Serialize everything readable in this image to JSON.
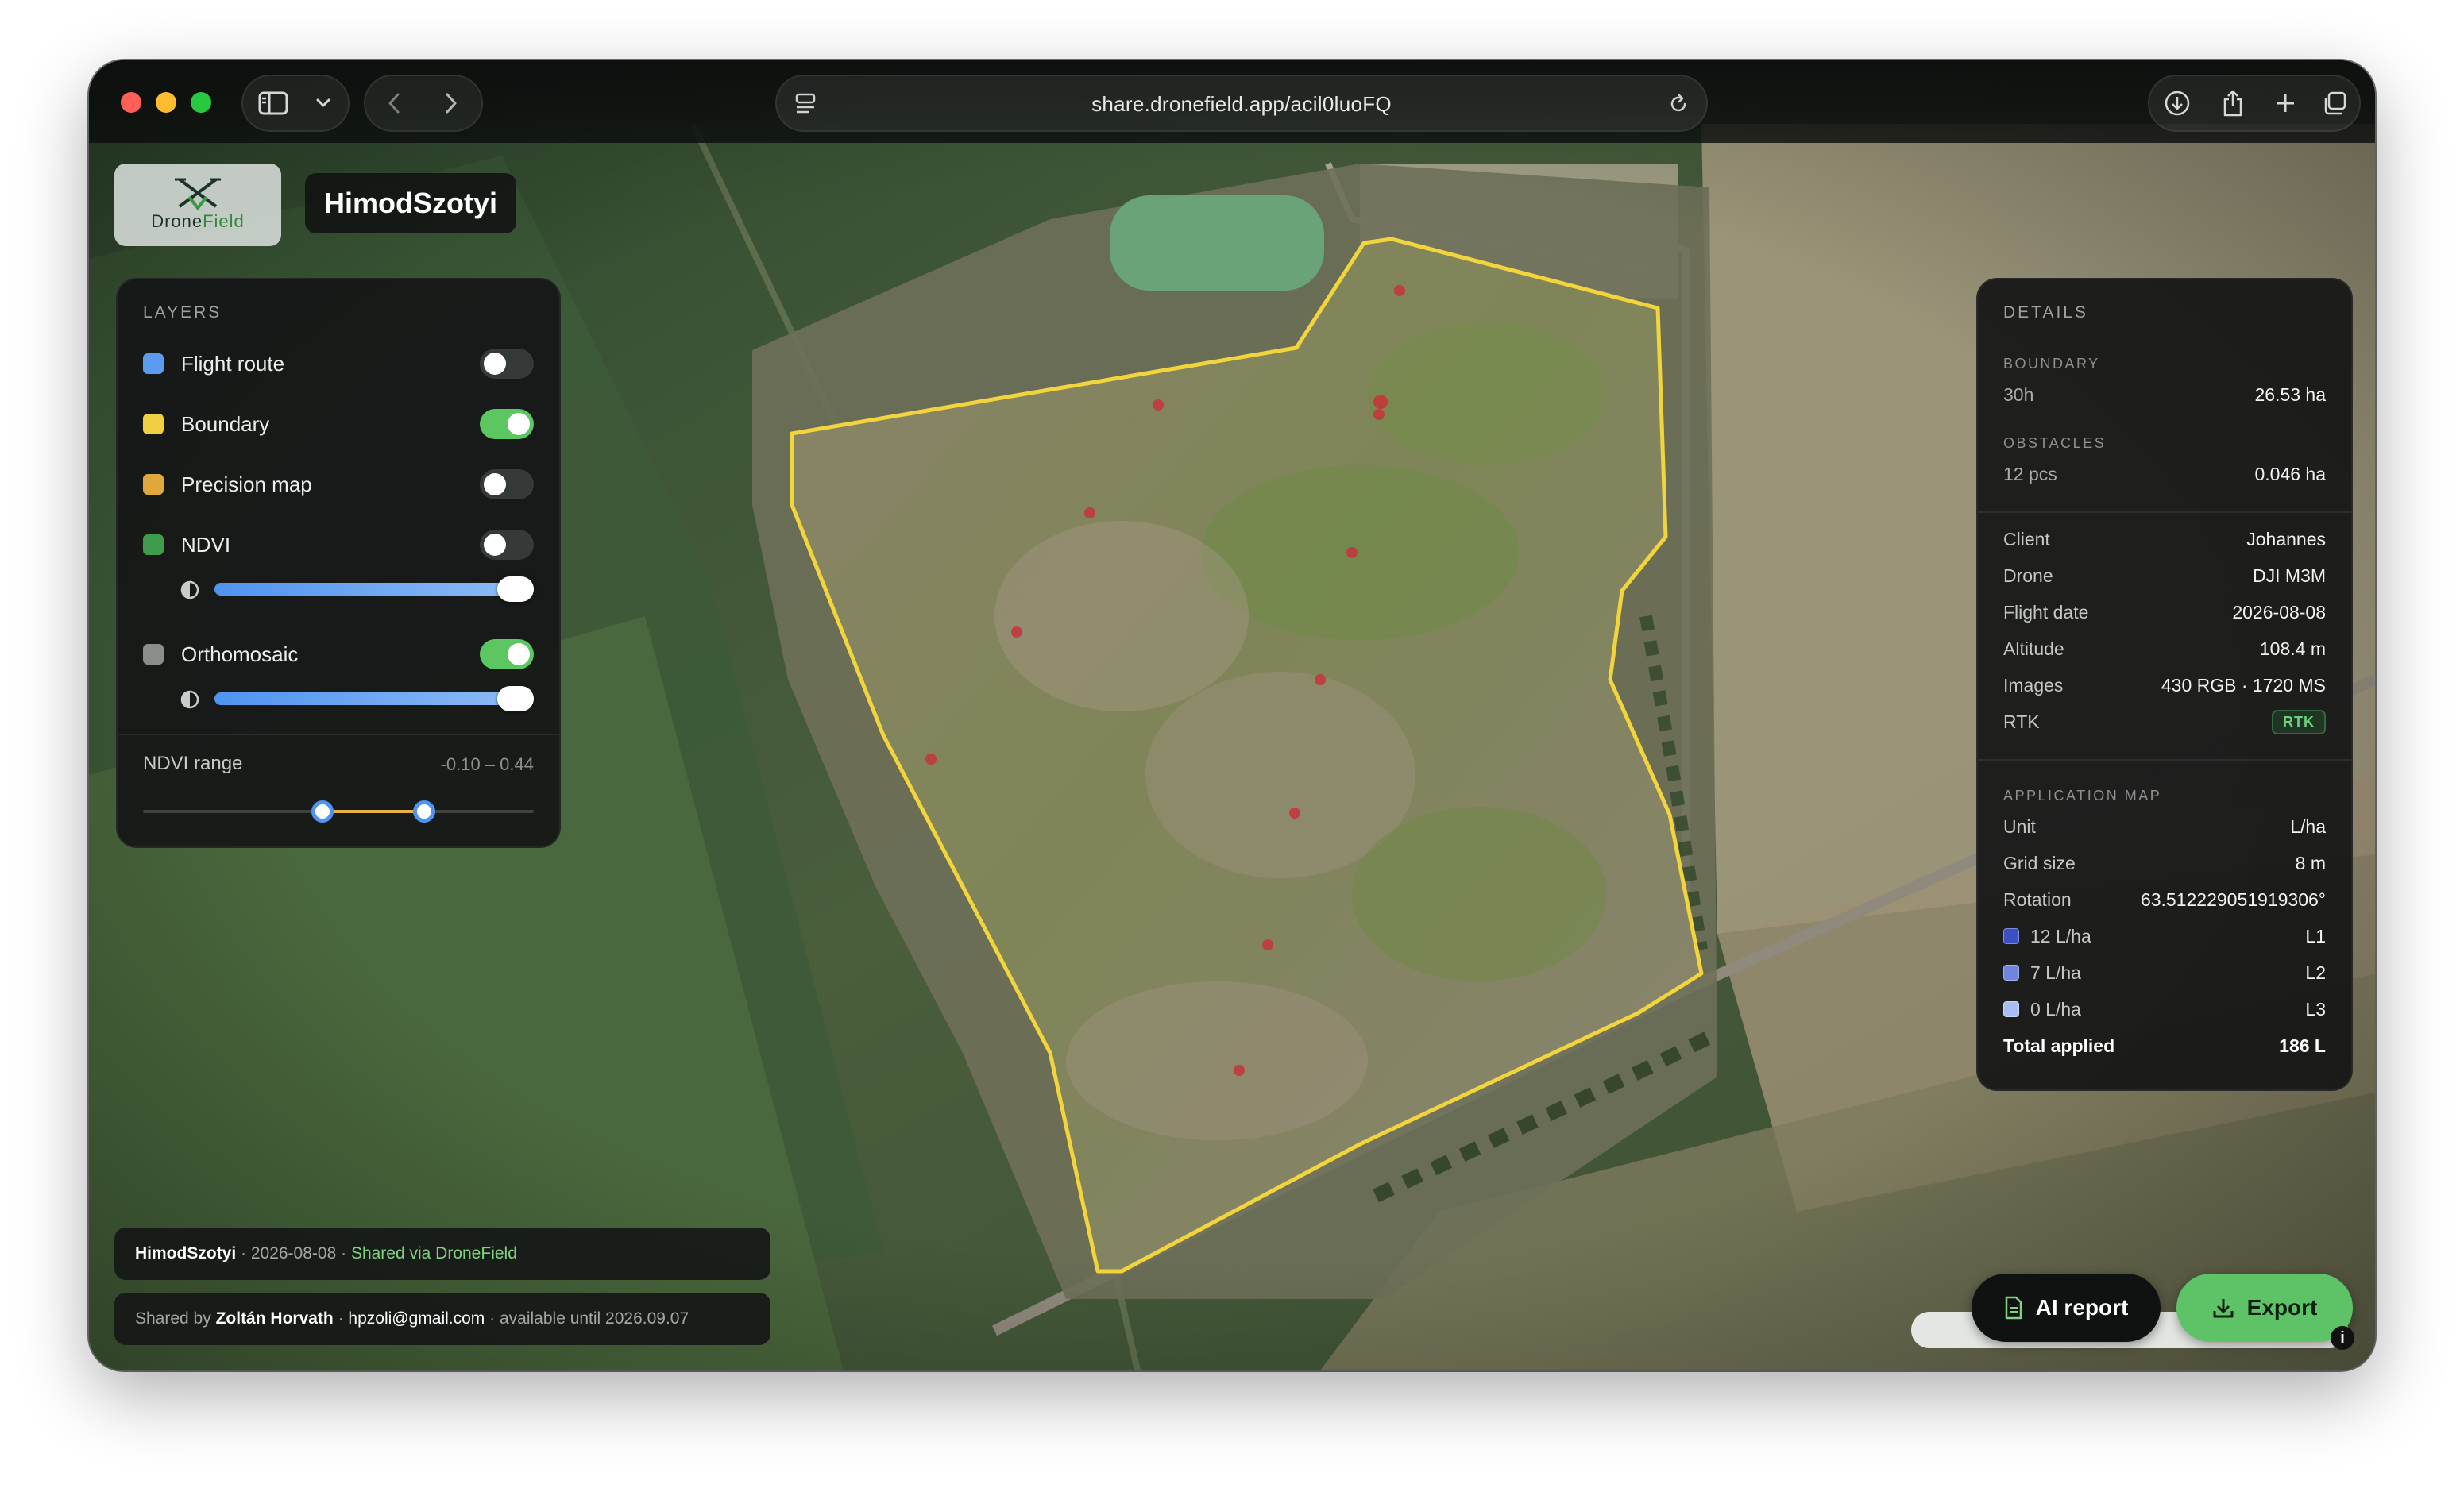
{
  "browser": {
    "url": "share.dronefield.app/acil0luoFQ",
    "colors": {
      "close": "#ff5f57",
      "minimize": "#febc2e",
      "zoom": "#28c840"
    },
    "icons": [
      "sidebar-icon",
      "chevron-down-icon",
      "back-icon",
      "forward-icon",
      "page-settings-icon",
      "reload-icon",
      "download-icon",
      "share-icon",
      "new-tab-icon",
      "tab-overview-icon"
    ]
  },
  "brand": {
    "logo_prefix": "Drone",
    "logo_suffix": "Field",
    "site_name": "HimodSzotyi"
  },
  "layers": {
    "title": "LAYERS",
    "items": [
      {
        "label": "Flight route",
        "color": "#5b9bf0",
        "enabled": false
      },
      {
        "label": "Boundary",
        "color": "#f0d042",
        "enabled": true
      },
      {
        "label": "Precision map",
        "color": "#e0a83c",
        "enabled": false
      },
      {
        "label": "NDVI",
        "color": "#3e9c4c",
        "enabled": false,
        "opacity": 1.0
      },
      {
        "label": "Orthomosaic",
        "color": "#8a8e8b",
        "enabled": true,
        "opacity": 1.0
      }
    ],
    "ndvi_range": {
      "label": "NDVI range",
      "value_text": "-0.10 – 0.44",
      "min": -0.1,
      "max": 0.44
    }
  },
  "details": {
    "title": "DETAILS",
    "boundary": {
      "label": "BOUNDARY",
      "name": "30h",
      "area": "26.53 ha"
    },
    "obstacles": {
      "label": "OBSTACLES",
      "count": "12 pcs",
      "area": "0.046 ha"
    },
    "rows": [
      {
        "key": "Client",
        "value": "Johannes"
      },
      {
        "key": "Drone",
        "value": "DJI M3M"
      },
      {
        "key": "Flight date",
        "value": "2026-08-08"
      },
      {
        "key": "Altitude",
        "value": "108.4 m"
      },
      {
        "key": "Images",
        "value": "430 RGB · 1720 MS"
      },
      {
        "key": "RTK",
        "badge": "RTK"
      }
    ],
    "application_map": {
      "label": "APPLICATION MAP",
      "rows": [
        {
          "key": "Unit",
          "value": "L/ha"
        },
        {
          "key": "Grid size",
          "value": "8 m"
        },
        {
          "key": "Rotation",
          "value": "63.512229051919306°"
        }
      ],
      "levels": [
        {
          "rate": "12 L/ha",
          "level": "L1",
          "color": "#3d4fc4"
        },
        {
          "rate": "7 L/ha",
          "level": "L2",
          "color": "#6f86dc"
        },
        {
          "rate": "0 L/ha",
          "level": "L3",
          "color": "#a9bdf2"
        }
      ],
      "total": {
        "key": "Total applied",
        "value": "186 L"
      }
    }
  },
  "footer": {
    "site": "HimodSzotyi",
    "sep1": " · ",
    "date": "2026-08-08",
    "sep2": " · ",
    "shared_via": "Shared via DroneField",
    "shared_by_prefix": "Shared by ",
    "owner_name": "Zoltán Horvath",
    "sep3": " · ",
    "owner_email": "hpzoli@gmail.com",
    "availability": " · available until 2026.09.07"
  },
  "actions": {
    "ai_report": "AI report",
    "export": "Export"
  },
  "map": {
    "boundary_color": "#f2d43c",
    "obstacle_color": "#c8323a"
  }
}
